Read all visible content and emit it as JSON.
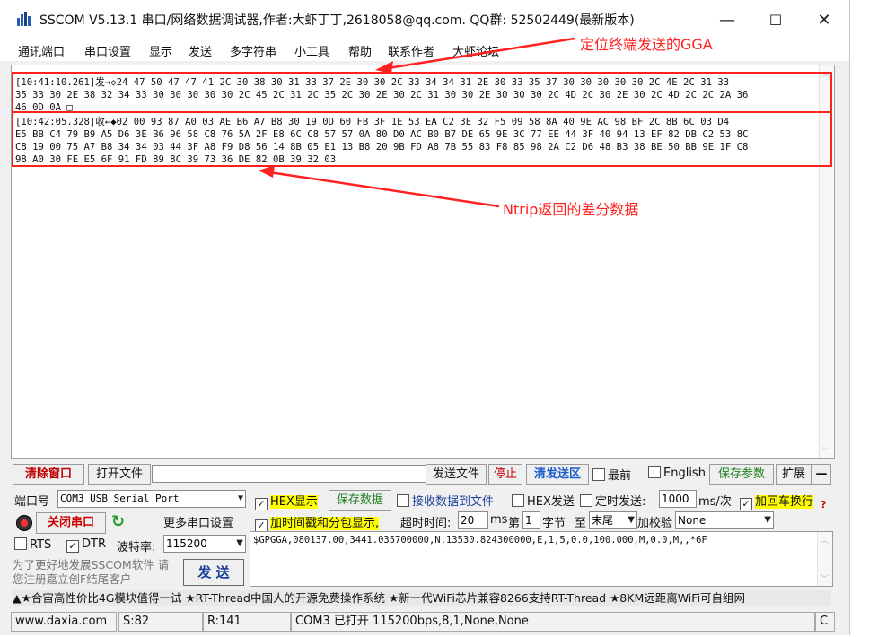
{
  "window": {
    "title": "SSCOM V5.13.1 串口/网络数据调试器,作者:大虾丁丁,2618058@qq.com. QQ群: 52502449(最新版本)",
    "min_glyph": "—",
    "max_glyph": "☐",
    "close_glyph": "✕"
  },
  "menu": [
    "通讯端口",
    "串口设置",
    "显示",
    "发送",
    "多字符串",
    "小工具",
    "帮助",
    "联系作者",
    "大虾论坛"
  ],
  "annotations": {
    "gga_label": "定位终端发送的GGA",
    "ntrip_label": "Ntrip返回的差分数据"
  },
  "receive": {
    "sent_lines": [
      "[10:41:10.261]发→◇24 47 50 47 47 41 2C 30 38 30 31 33 37 2E 30 30 2C 33 34 34 31 2E 30 33 35 37 30 30 30 30 30 2C 4E 2C 31 33",
      "35 33 30 2E 38 32 34 33 30 30 30 30 30 2C 45 2C 31 2C 35 2C 30 2E 30 2C 31 30 30 2E 30 30 30 2C 4D 2C 30 2E 30 2C 4D 2C 2C 2A 36",
      "46 0D 0A □"
    ],
    "recv_lines": [
      "[10:42:05.328]收←◆02 00 93 87 A0 03 AE B6 A7 B8 30 19 0D 60 FB 3F 1E 53 EA C2 3E 32 F5 09 58 8A 40 9E AC 98 BF 2C 8B 6C 03 D4",
      "E5 BB C4 79 B9 A5 D6 3E B6 96 58 C8 76 5A 2F E8 6C C8 57 57 0A 80 D0 AC B0 B7 DE 65 9E 3C 77 EE 44 3F 40 94 13 EF 82 DB C2 53 8C",
      "C8 19 00 75 A7 B8 34 34 03 44 3F A8 F9 D8 56 14 8B 05 E1 13 B8 20 9B FD A8 7B 55 83 F8 85 98 2A C2 D6 48 B3 38 BE 50 BB 9E 1F C8",
      "98 A0 30 FE E5 6F 91 FD 89 8C 39 73 36 DE 82 0B 39 32 03"
    ]
  },
  "toolbar": {
    "clear_window": "清除窗口",
    "open_file": "打开文件",
    "send_file": "发送文件",
    "stop": "停止",
    "clear_send": "清发送区",
    "topmost": "最前",
    "english": "English",
    "save_params": "保存参数",
    "expand": "扩展",
    "collapse": "—"
  },
  "port_panel": {
    "port_label": "端口号",
    "port_value": "COM3 USB Serial Port",
    "close_port": "关闭串口",
    "more_settings": "更多串口设置",
    "rts": "RTS",
    "dtr": "DTR",
    "baud_label": "波特率:",
    "baud_value": "115200",
    "promo": "为了更好地发展SSCOM软件 请您注册嘉立创F结尾客户",
    "send_button": "发 送"
  },
  "options": {
    "hex_display": "HEX显示",
    "save_data": "保存数据",
    "recv_to_file": "接收数据到文件",
    "hex_send": "HEX发送",
    "timed_send": "定时发送:",
    "interval": "1000",
    "interval_unit": "ms/次",
    "add_crlf": "加回车换行",
    "timestamp": "加时间戳和分包显示,",
    "timeout_label": "超时时间:",
    "timeout_value": "20",
    "timeout_unit": "ms",
    "byte_prefix": "第",
    "byte_value": "1",
    "byte_suffix": "字节",
    "to_label": "至",
    "to_value": "末尾",
    "checksum_label": "加校验",
    "checksum_value": "None",
    "question": "?"
  },
  "send_text": "$GPGGA,080137.00,3441.035700000,N,13530.824300000,E,1,5,0.0,100.000,M,0.0,M,,*6F",
  "ticker": "▲★合宙高性价比4G模块值得一试 ★RT-Thread中国人的开源免费操作系统 ★新一代WiFi芯片兼容8266支持RT-Thread ★8KM远距离WiFi可自组网",
  "statusbar": {
    "website": "www.daxia.com",
    "sent": "S:82",
    "received": "R:141",
    "port_status": "COM3 已打开  115200bps,8,1,None,None",
    "tail": "C"
  },
  "colors": {
    "annotation_red": "#ff2020",
    "highlight_yellow": "#ffff00",
    "clear_button_red": "#c00000",
    "close_port_red": "#cc0000",
    "refresh_green": "#2a9d2a"
  }
}
